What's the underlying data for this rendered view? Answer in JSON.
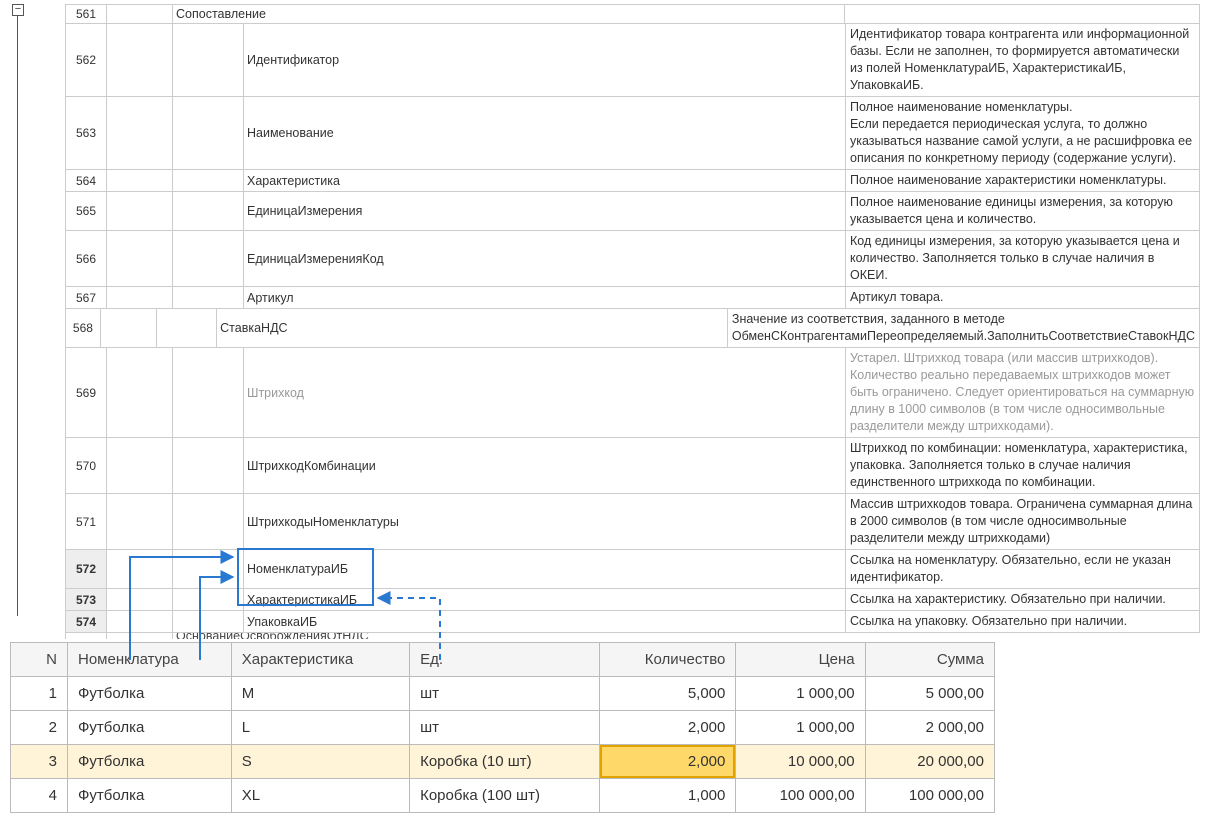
{
  "tree": {
    "collapse_symbol": "−",
    "rows": [
      {
        "n": "561",
        "lvl": 0,
        "name": "Сопоставление",
        "desc": ""
      },
      {
        "n": "562",
        "lvl": 1,
        "name": "Идентификатор",
        "desc": "Идентификатор товара контрагента или информационной базы. Если не заполнен, то формируется автоматически из полей НоменклатураИБ, ХарактеристикаИБ, УпаковкаИБ."
      },
      {
        "n": "563",
        "lvl": 1,
        "name": "Наименование",
        "desc": "Полное наименование номенклатуры.\nЕсли передается периодическая услуга, то должно указываться название самой услуги, а не расшифровка ее описания по конкретному периоду (содержание услуги)."
      },
      {
        "n": "564",
        "lvl": 1,
        "name": "Характеристика",
        "desc": "Полное наименование характеристики номенклатуры."
      },
      {
        "n": "565",
        "lvl": 1,
        "name": "ЕдиницаИзмерения",
        "desc": "Полное наименование единицы измерения, за которую указывается цена и количество."
      },
      {
        "n": "566",
        "lvl": 1,
        "name": "ЕдиницаИзмеренияКод",
        "desc": "Код единицы измерения, за которую указывается цена и количество. Заполняется только в случае наличия в ОКЕИ."
      },
      {
        "n": "567",
        "lvl": 1,
        "name": "Артикул",
        "desc": "Артикул товара."
      },
      {
        "n": "568",
        "lvl": 1,
        "name": "СтавкаНДС",
        "desc": "Значение из соответствия, заданного в методе ОбменСКонтрагентамиПереопределяемый.ЗаполнитьСоответствиеСтавокНДС"
      },
      {
        "n": "569",
        "lvl": 1,
        "name": "Штрихкод",
        "muted": true,
        "desc": "Устарел. Штрихкод товара (или массив штрихкодов). Количество реально передаваемых штрихкодов может быть ограничено. Следует ориентироваться на суммарную длину в 1000 символов (в том числе односимвольные разделители между штрихкодами)."
      },
      {
        "n": "570",
        "lvl": 1,
        "name": "ШтрихкодКомбинации",
        "desc": "Штрихкод по комбинации: номенклатура, характеристика, упаковка. Заполняется только в случае наличия единственного штрихкода по комбинации."
      },
      {
        "n": "571",
        "lvl": 1,
        "name": "ШтрихкодыНоменклатуры",
        "desc": "Массив штрихкодов товара. Ограничена суммарная длина в 2000 символов (в том числе односимвольные разделители между штрихкодами)"
      },
      {
        "n": "572",
        "lvl": 1,
        "hl": true,
        "sel": true,
        "name": "НоменклатураИБ",
        "desc": "Ссылка на номенклатуру. Обязательно, если не указан идентификатор."
      },
      {
        "n": "573",
        "lvl": 1,
        "hl": true,
        "sel": true,
        "name": "ХарактеристикаИБ",
        "desc": "Ссылка на характеристику. Обязательно при наличии."
      },
      {
        "n": "574",
        "lvl": 1,
        "hl": true,
        "sel": true,
        "name": "УпаковкаИБ",
        "desc": "Ссылка на упаковку. Обязательно при наличии."
      }
    ],
    "truncated_row": "ОснованиеОсвобожденияОтНДС"
  },
  "table": {
    "headers": [
      "N",
      "Номенклатура",
      "Характеристика",
      "Ед.",
      "Количество",
      "Цена",
      "Сумма"
    ],
    "rows": [
      {
        "n": "1",
        "nom": "Футболка",
        "ch": "M",
        "ed": "шт",
        "qty": "5,000",
        "price": "1 000,00",
        "sum": "5 000,00"
      },
      {
        "n": "2",
        "nom": "Футболка",
        "ch": "L",
        "ed": "шт",
        "qty": "2,000",
        "price": "1 000,00",
        "sum": "2 000,00"
      },
      {
        "n": "3",
        "nom": "Футболка",
        "ch": "S",
        "ed": "Коробка (10 шт)",
        "qty": "2,000",
        "price": "10 000,00",
        "sum": "20 000,00",
        "sel": true,
        "cur": "qty"
      },
      {
        "n": "4",
        "nom": "Футболка",
        "ch": "XL",
        "ed": "Коробка (100 шт)",
        "qty": "1,000",
        "price": "100 000,00",
        "sum": "100 000,00"
      }
    ]
  }
}
